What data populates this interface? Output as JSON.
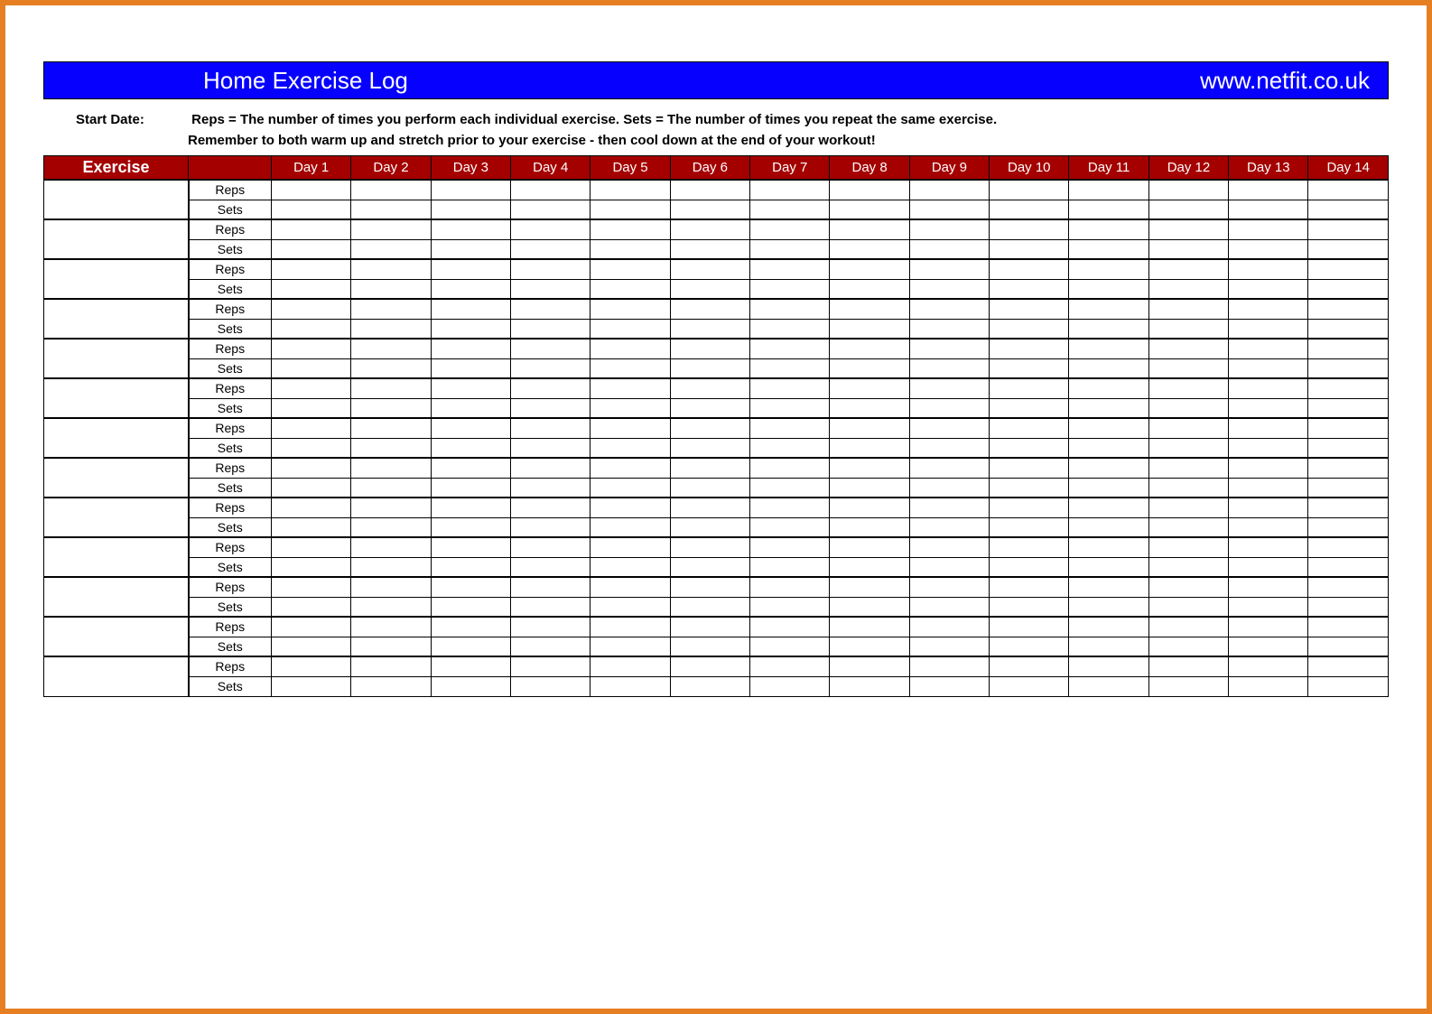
{
  "banner": {
    "title": "Home Exercise Log",
    "site": "www.netfit.co.uk"
  },
  "info": {
    "start_date_label": "Start Date:",
    "line1": "Reps =  The number of times you perform each individual exercise. Sets =  The number of times you repeat the same exercise.",
    "line2": "Remember to both warm up and stretch prior to your exercise - then cool down at the end of your workout!"
  },
  "table": {
    "exercise_header": "Exercise",
    "blank_header": "",
    "day_headers": [
      "Day 1",
      "Day 2",
      "Day 3",
      "Day 4",
      "Day 5",
      "Day 6",
      "Day 7",
      "Day 8",
      "Day 9",
      "Day 10",
      "Day 11",
      "Day 12",
      "Day 13",
      "Day 14"
    ],
    "row_labels": {
      "reps": "Reps",
      "sets": "Sets"
    },
    "exercise_count": 13
  }
}
